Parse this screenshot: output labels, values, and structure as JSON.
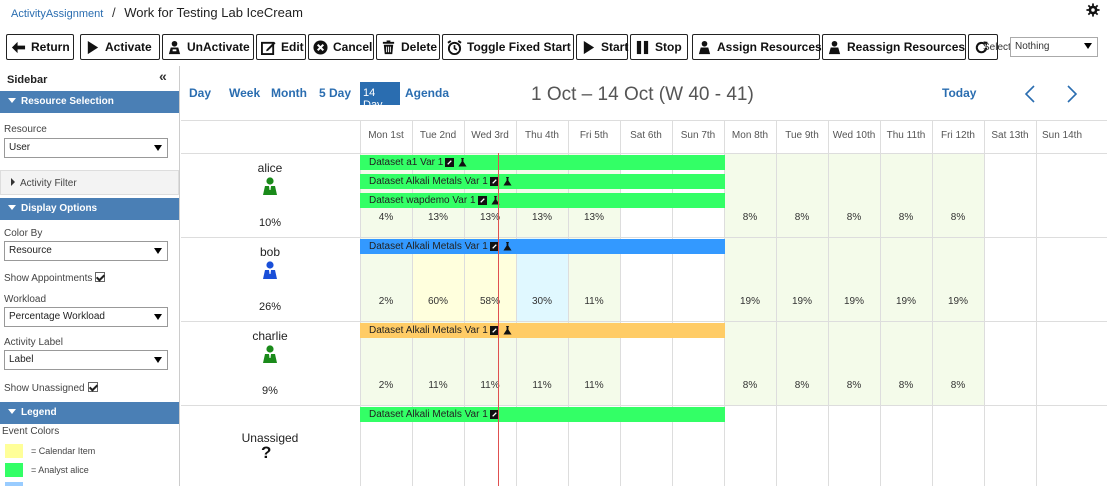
{
  "breadcrumb": {
    "root": "ActivityAssignment",
    "separator": "/",
    "current": "Work for Testing Lab IceCream"
  },
  "toolbar": {
    "return_label": "Return",
    "activate_label": "Activate",
    "unactivate_label": "UnActivate",
    "edit_label": "Edit",
    "cancel_label": "Cancel",
    "delete_label": "Delete",
    "toggle_fixed_start_label": "Toggle Fixed Start",
    "start_label": "Start",
    "stop_label": "Stop",
    "assign_resources_label": "Assign Resources",
    "reassign_resources_label": "Reassign Resources",
    "select_label": "Select",
    "select_value": "Nothing"
  },
  "sidebar": {
    "title": "Sidebar",
    "collapse_glyph": "«",
    "resource_selection": {
      "header": "Resource Selection",
      "resource_label": "Resource",
      "resource_value": "User"
    },
    "activity_filter": {
      "header": "Activity Filter"
    },
    "display_options": {
      "header": "Display Options",
      "color_by_label": "Color By",
      "color_by_value": "Resource",
      "show_appointments_label": "Show Appointments",
      "show_appointments_checked": true,
      "workload_label": "Workload",
      "workload_value": "Percentage Workload",
      "activity_label_label": "Activity Label",
      "activity_label_value": "Label",
      "show_unassigned_label": "Show Unassigned",
      "show_unassigned_checked": true
    },
    "legend": {
      "header": "Legend",
      "subtitle": "Event Colors",
      "items": [
        {
          "label": "= Calendar Item",
          "color": "#ffff99"
        },
        {
          "label": "= Analyst alice",
          "color": "#33ff66"
        },
        {
          "label": "",
          "color": "#99ccff"
        }
      ]
    }
  },
  "calendar": {
    "views": {
      "day": "Day",
      "week": "Week",
      "month": "Month",
      "five_day": "5 Day",
      "fourteen_day": "14 Day",
      "agenda": "Agenda"
    },
    "active_view": "14 Day",
    "range_title": "1 Oct – 14 Oct (W 40 - 41)",
    "today_label": "Today",
    "days": [
      "Mon 1st",
      "Tue 2nd",
      "Wed 3rd",
      "Thu 4th",
      "Fri 5th",
      "Sat 6th",
      "Sun 7th",
      "Mon 8th",
      "Tue 9th",
      "Wed 10th",
      "Thu 11th",
      "Fri 12th",
      "Sat 13th",
      "Sun 14th"
    ],
    "colors": {
      "green": "#33ff66",
      "blue": "#3399ff",
      "orange": "#ffcc66",
      "weekday_tint": "#f4fbea",
      "yellow_tint": "#ffffdd",
      "cyan_tint": "#e0f8ff",
      "now_line": "#e05050"
    },
    "resources": [
      {
        "name": "alice",
        "icon_color": "#1a8a1a",
        "total": "10%",
        "percentages": [
          "4%",
          "13%",
          "13%",
          "13%",
          "13%",
          "",
          "",
          "8%",
          "8%",
          "8%",
          "8%",
          "8%",
          "",
          ""
        ],
        "events": [
          {
            "label": "Dataset a1 Var 1",
            "color": "#33ff66"
          },
          {
            "label": "Dataset Alkali Metals Var 1",
            "color": "#33ff66"
          },
          {
            "label": "Dataset wapdemo Var 1",
            "color": "#33ff66"
          }
        ]
      },
      {
        "name": "bob",
        "icon_color": "#1a4fd8",
        "total": "26%",
        "percentages": [
          "2%",
          "60%",
          "58%",
          "30%",
          "11%",
          "",
          "",
          "19%",
          "19%",
          "19%",
          "19%",
          "19%",
          "",
          ""
        ],
        "events": [
          {
            "label": "Dataset Alkali Metals Var 1",
            "color": "#3399ff"
          }
        ]
      },
      {
        "name": "charlie",
        "icon_color": "#1a8a1a",
        "total": "9%",
        "percentages": [
          "2%",
          "11%",
          "11%",
          "11%",
          "11%",
          "",
          "",
          "8%",
          "8%",
          "8%",
          "8%",
          "8%",
          "",
          ""
        ],
        "events": [
          {
            "label": "Dataset Alkali Metals Var 1",
            "color": "#ffcc66"
          }
        ]
      },
      {
        "name": "Unassiged",
        "icon": "?",
        "total": "",
        "percentages": [],
        "events": [
          {
            "label": "Dataset Alkali Metals Var 1",
            "color": "#33ff66"
          }
        ]
      }
    ]
  }
}
